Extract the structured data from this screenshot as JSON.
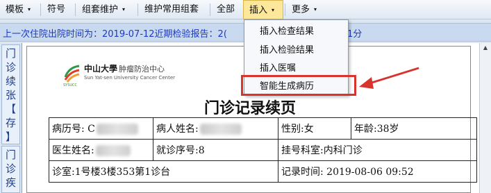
{
  "toolbar": {
    "items": [
      {
        "label": "模板",
        "caret": "▾"
      },
      {
        "label": "符号",
        "caret": ""
      },
      {
        "label": "组套维护",
        "caret": "▾"
      },
      {
        "label": "维护常用组套",
        "caret": ""
      },
      {
        "label": "全部",
        "caret": ""
      },
      {
        "label": "插入",
        "caret": "▾"
      },
      {
        "label": "更多",
        "caret": "▾"
      }
    ]
  },
  "infobar": {
    "text": "上一次住院出院时间为：2019-07-12近期检验报告：2(",
    "tail": "1分"
  },
  "vertical_tabs": {
    "tab1": [
      "门",
      "诊",
      "续",
      "张",
      "【",
      "存",
      "】"
    ],
    "tab2": [
      "门",
      "诊",
      "疾"
    ]
  },
  "insert_menu": {
    "items": [
      "插入检查结果",
      "插入检验结果",
      "插入医嘱",
      "智能生成病历"
    ],
    "highlighted": "智能生成病历"
  },
  "logo": {
    "cn_name": "中山大學",
    "cn_sub": "肿瘤防治中心",
    "en_name": "Sun Yat-sen University Cancer Center",
    "small": "SYSUCC"
  },
  "document": {
    "title": "门诊记录续页",
    "row1": {
      "record_label": "病历号:",
      "record_value": "C",
      "patient_label": "病人姓名:",
      "gender": "性别:女",
      "age": "年龄:38岁"
    },
    "row2": {
      "doctor_label": "医生姓名:",
      "visit_no": "就诊序号:8",
      "dept": "挂号科室:内科门诊"
    },
    "row3": {
      "room": "诊室:1号楼3楼353第1诊台",
      "record_time": "记录时间: 2019-08-06 09:52"
    }
  },
  "colors": {
    "accent_red": "#d9332d",
    "info_text": "#1b38c4"
  }
}
